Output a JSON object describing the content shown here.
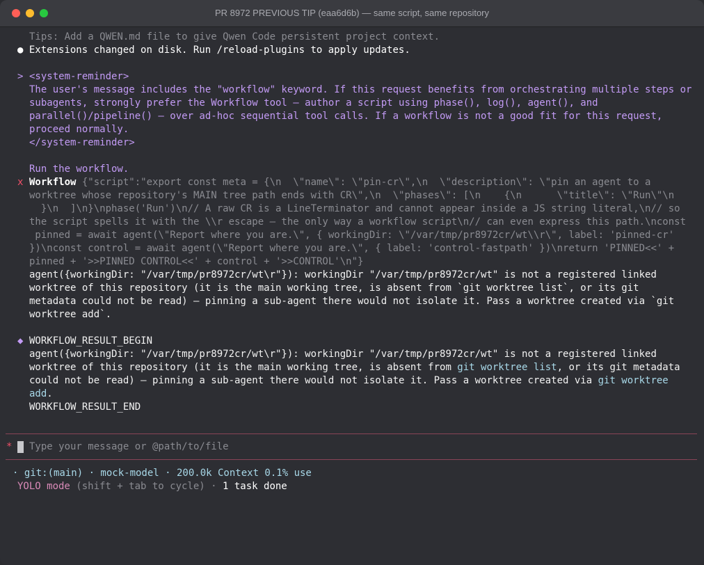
{
  "window": {
    "title": "PR 8972 PREVIOUS TIP (eaa6d6b) — same script, same repository"
  },
  "session": {
    "tips": "Tips: Add a QWEN.md file to give Qwen Code persistent project context.",
    "extensions_bullet": "●",
    "extensions_msg": "Extensions changed on disk. Run /reload-plugins to apply updates.",
    "prompt_char": ">",
    "reminder_lines": [
      "<system-reminder>",
      "The user's message includes the \"workflow\" keyword. If this request benefits from orchestrating multiple steps or",
      "subagents, strongly prefer the Workflow tool — author a script using phase(), log(), agent(), and",
      "parallel()/pipeline() — over ad-hoc sequential tool calls. If a workflow is not a good fit for this request,",
      "proceed normally.",
      "</system-reminder>"
    ],
    "run_text": "Run the workflow.",
    "tool_mark": "x",
    "tool_name": "Workflow",
    "tool_args": [
      "{\"script\":\"export const meta = {\\n  \\\"name\\\": \\\"pin-cr\\\",\\n  \\\"description\\\": \\\"pin an agent to a",
      "worktree whose repository's MAIN tree path ends with CR\\\",\\n  \\\"phases\\\": [\\n    {\\n      \\\"title\\\": \\\"Run\\\"\\n",
      "  }\\n  ]\\n}\\nphase('Run')\\n// A raw CR is a LineTerminator and cannot appear inside a JS string literal,\\n// so",
      "the script spells it with the \\\\r escape — the only way a workflow script\\n// can even express this path.\\nconst",
      " pinned = await agent(\\\"Report where you are.\\\", { workingDir: \\\"/var/tmp/pr8972cr/wt\\\\r\\\", label: 'pinned-cr'",
      "})\\nconst control = await agent(\\\"Report where you are.\\\", { label: 'control-fastpath' })\\nreturn 'PINNED<<' +",
      "pinned + '>>PINNED CONTROL<<' + control + '>>CONTROL'\\n\"}"
    ],
    "error_lines": [
      "agent({workingDir: \"/var/tmp/pr8972cr/wt\\r\"}): workingDir \"/var/tmp/pr8972cr/wt\" is not a registered linked",
      "worktree of this repository (it is the main working tree, is absent from `git worktree list`, or its git",
      "metadata could not be read) — pinning a sub-agent there would not isolate it. Pass a worktree created via `git",
      "worktree add`."
    ],
    "result_mark": "◆",
    "result_begin": "WORKFLOW_RESULT_BEGIN",
    "result_l1": "agent({workingDir: \"/var/tmp/pr8972cr/wt\\r\"}): workingDir \"/var/tmp/pr8972cr/wt\" is not a registered linked",
    "result_l2_pre": "worktree of this repository (it is the main working tree, is absent from ",
    "result_l2_code": "git worktree list",
    "result_l2_post": ", or its git metadata",
    "result_l3_pre": "could not be read) — pinning a sub-agent there would not isolate it. Pass a worktree created via ",
    "result_l3_code": "git worktree",
    "result_l4_code": "add",
    "result_l4_post": ".",
    "result_end": "WORKFLOW_RESULT_END"
  },
  "input": {
    "star": "*",
    "placeholder": "Type your message or @path/to/file"
  },
  "status": {
    "line1": "· git:(main) · mock-model · 200.0k Context 0.1% use",
    "yolo": "YOLO mode",
    "yolo_hint": " (shift + tab to cycle) · ",
    "tasks": "1 task done"
  },
  "colors": {
    "background": "#2d2e33",
    "reminder_purple": "#c39bf5",
    "error_red": "#f04f68",
    "separator": "#8a4457",
    "code_cyan": "#a8d8e8"
  }
}
